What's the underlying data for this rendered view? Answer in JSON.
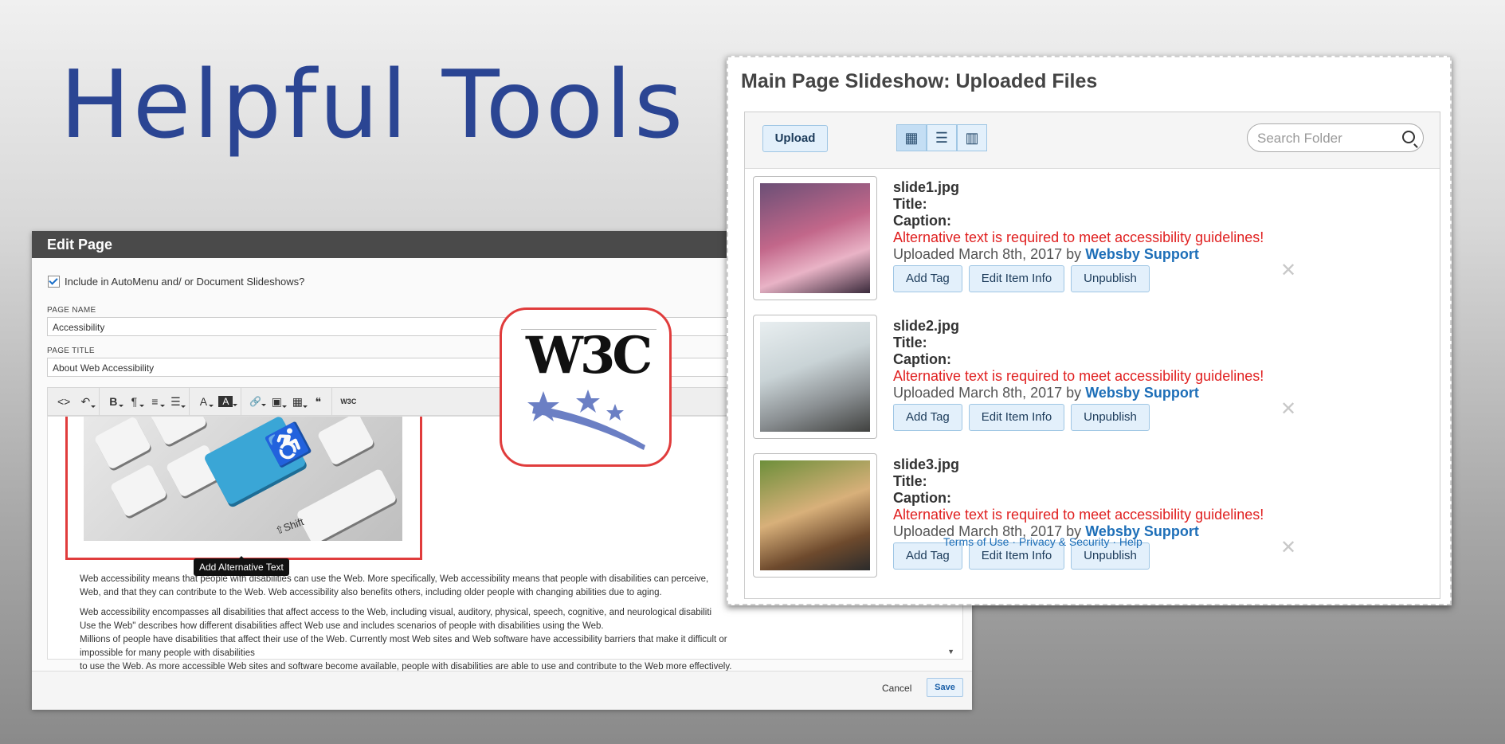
{
  "hero": {
    "title": "Helpful Tools"
  },
  "edit_page": {
    "header": "Edit Page",
    "include_label": "Include in AutoMenu and/ or Document Slideshows?",
    "page_name_label": "PAGE NAME",
    "page_name_value": "Accessibility",
    "page_title_label": "PAGE TITLE",
    "page_title_value": "About Web Accessibility",
    "toolbar": {
      "source": "<>",
      "undo": "↶",
      "bold": "B",
      "para": "¶",
      "align": "≡",
      "list": "☰",
      "font": "A",
      "bg": "A",
      "link": "🔗",
      "image": "▣",
      "table": "▦",
      "quote": "❝",
      "w3c": "W3C"
    },
    "tooltip": "Add Alternative Text",
    "paragraphs": [
      "Web accessibility means that people with disabilities can use the Web. More specifically, Web accessibility means that people with disabilities can perceive,\nWeb, and that they can contribute to the Web. Web accessibility also benefits others, including older people with changing abilities due to aging.",
      "Web accessibility encompasses all disabilities that affect access to the Web, including visual, auditory, physical, speech, cognitive, and neurological disabiliti\nUse the Web\" describes how different disabilities affect Web use and includes scenarios of people with disabilities using the Web.",
      "Millions of people have disabilities that affect their use of the Web. Currently most Web sites and Web software have accessibility barriers that make it difficult or impossible for many people with disabilities\nto use the Web. As more accessible Web sites and software become available, people with disabilities are able to use and contribute to the Web more effectively."
    ],
    "key_label": "⇧Shift",
    "cancel": "Cancel",
    "save": "Save"
  },
  "callout": {
    "logo_text": "W3C"
  },
  "slideshow": {
    "title": "Main Page Slideshow: Uploaded Files",
    "upload": "Upload",
    "search_placeholder": "Search Folder",
    "labels": {
      "title": "Title:",
      "caption": "Caption:",
      "uploaded_prefix": "Uploaded",
      "by": "by",
      "add_tag": "Add Tag",
      "edit_info": "Edit Item Info",
      "unpublish": "Unpublish"
    },
    "files": [
      {
        "name": "slide1.jpg",
        "warning": "Alternative text is required to meet accessibility guidelines!",
        "date": "March 8th, 2017",
        "author": "Websby Support"
      },
      {
        "name": "slide2.jpg",
        "warning": "Alternative text is required to meet accessibility guidelines!",
        "date": "March 8th, 2017",
        "author": "Websby Support"
      },
      {
        "name": "slide3.jpg",
        "warning": "Alternative text is required to meet accessibility guidelines!",
        "date": "March 8th, 2017",
        "author": "Websby Support"
      }
    ],
    "footer": "Terms of Use · Privacy & Security · Help"
  },
  "colors": {
    "title_blue": "#2b4593",
    "warning_red": "#e02020",
    "link_blue": "#1e6fb8",
    "callout_red": "#e03c3c"
  }
}
